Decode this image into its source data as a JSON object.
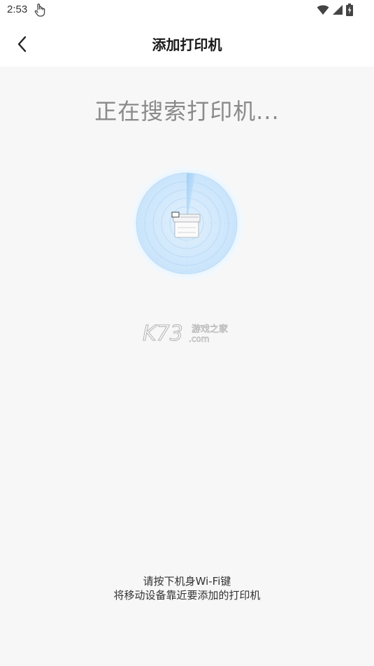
{
  "status_bar": {
    "time": "2:53",
    "icons": [
      "touch-hand-icon",
      "wifi-icon",
      "cell-signal-icon",
      "battery-charging-icon"
    ]
  },
  "nav": {
    "title": "添加打印机",
    "back_icon": "chevron-left-icon"
  },
  "main": {
    "searching_text": "正在搜索打印机...",
    "radar_icon": "printer-radar-icon",
    "watermark": {
      "brand": "K73",
      "cn": "游戏之家",
      "domain": ".com"
    }
  },
  "hint": {
    "line1": "请按下机身Wi-Fi键",
    "line2": "将移动设备靠近要添加的打印机"
  }
}
